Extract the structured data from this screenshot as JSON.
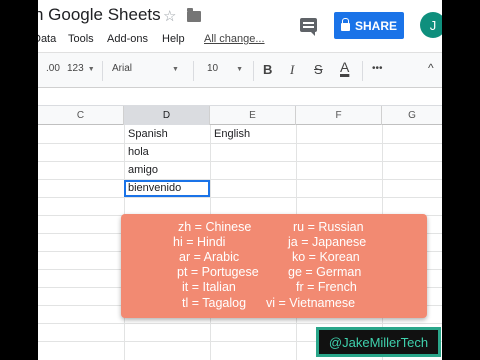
{
  "title_bar": {
    "doc_title": "n Google Sheets",
    "share_label": "SHARE",
    "avatar_initial": "J"
  },
  "menu": {
    "items": [
      "Data",
      "Tools",
      "Add-ons",
      "Help"
    ],
    "last_edit": "All change..."
  },
  "toolbar": {
    "decimal_more": ".00",
    "number_format": "123",
    "font_name": "Arial",
    "font_size": "10",
    "bold": "B",
    "italic": "I",
    "strike": "S",
    "text_color": "A",
    "more": "•••",
    "collapse": "^"
  },
  "grid": {
    "columns": [
      "C",
      "D",
      "E",
      "F",
      "G"
    ],
    "selected_column": "D",
    "cells": {
      "d1": "Spanish",
      "e1": "English",
      "d2": "hola",
      "d3": "amigo",
      "d4": "bienvenido"
    }
  },
  "languages": {
    "left": [
      "zh = Chinese",
      "hi = Hindi",
      "ar = Arabic",
      "pt = Portugese",
      "it = Italian",
      "tl = Tagalog"
    ],
    "right": [
      "ru = Russian",
      "ja = Japanese",
      "ko = Korean",
      "ge = German",
      "fr = French",
      "vi = Vietnamese"
    ]
  },
  "watermark": "@JakeMillerTech",
  "colors": {
    "share_blue": "#1a73e8",
    "card_orange": "#f28a72",
    "watermark_green": "#2aa68a",
    "avatar_teal": "#0f8f7d"
  }
}
